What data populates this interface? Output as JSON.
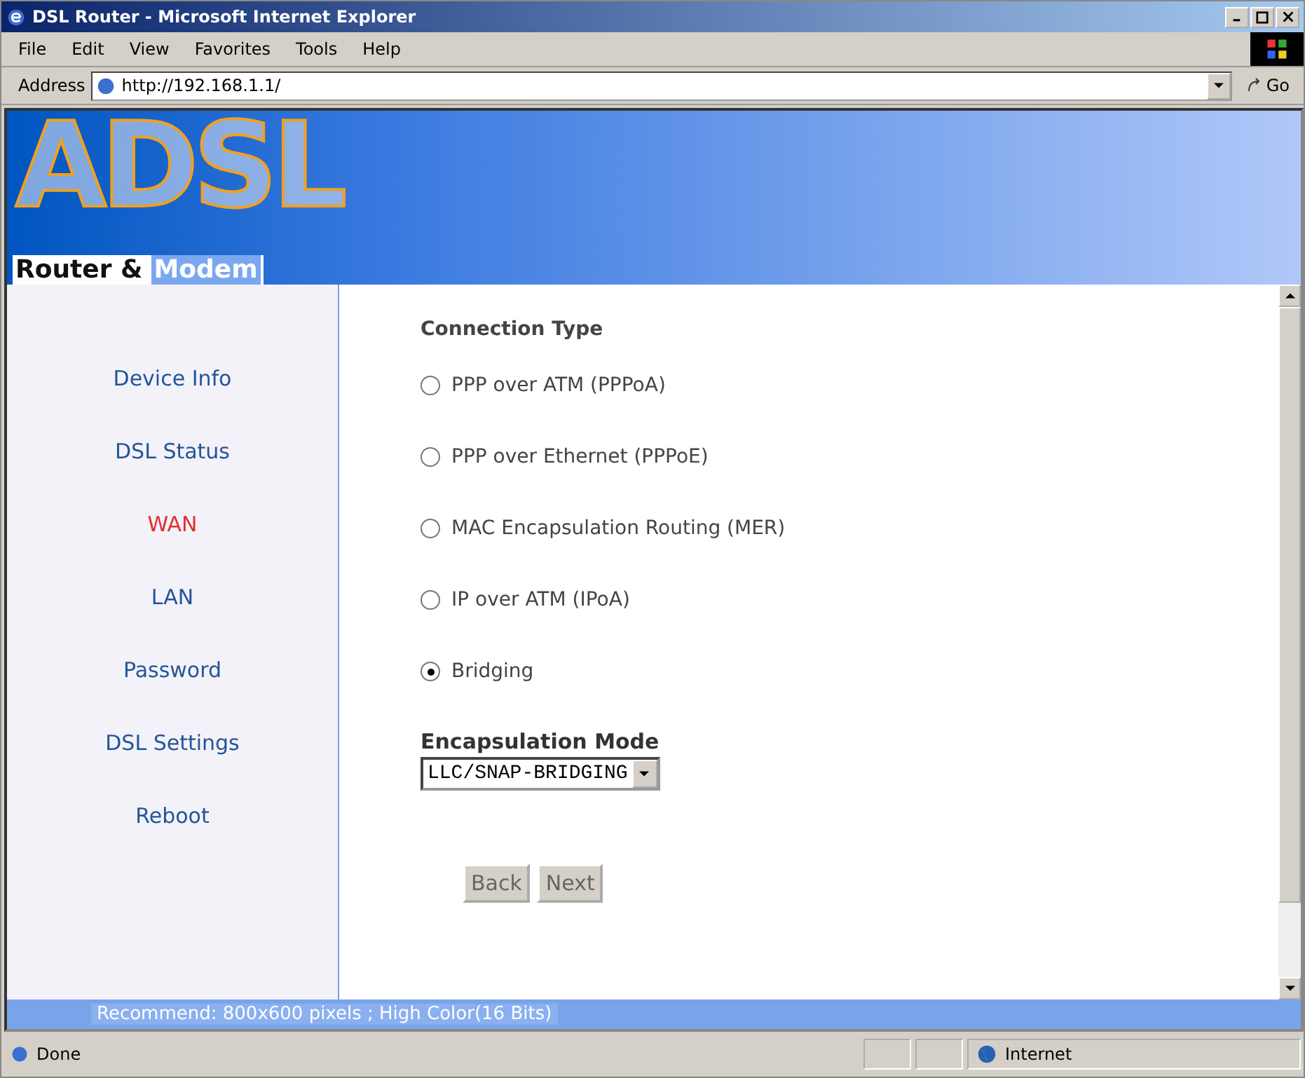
{
  "window": {
    "title": "DSL Router - Microsoft Internet Explorer"
  },
  "menu": [
    "File",
    "Edit",
    "View",
    "Favorites",
    "Tools",
    "Help"
  ],
  "address": {
    "label": "Address",
    "url": "http://192.168.1.1/",
    "go": "Go"
  },
  "banner": {
    "logo": "ADSL",
    "tagline_1": "Router &",
    "tagline_2": "Modem"
  },
  "sidebar": {
    "items": [
      {
        "label": "Device Info",
        "selected": false
      },
      {
        "label": "DSL Status",
        "selected": false
      },
      {
        "label": "WAN",
        "selected": true
      },
      {
        "label": "LAN",
        "selected": false
      },
      {
        "label": "Password",
        "selected": false
      },
      {
        "label": "DSL Settings",
        "selected": false
      },
      {
        "label": "Reboot",
        "selected": false
      }
    ]
  },
  "connection_type": {
    "heading": "Connection Type",
    "options": [
      {
        "label": "PPP over ATM (PPPoA)",
        "selected": false
      },
      {
        "label": "PPP over Ethernet (PPPoE)",
        "selected": false
      },
      {
        "label": "MAC Encapsulation Routing (MER)",
        "selected": false
      },
      {
        "label": "IP over ATM (IPoA)",
        "selected": false
      },
      {
        "label": "Bridging",
        "selected": true
      }
    ]
  },
  "encapsulation": {
    "heading": "Encapsulation Mode",
    "value": "LLC/SNAP-BRIDGING"
  },
  "buttons": [
    "Back",
    "Next"
  ],
  "footer": "Recommend: 800x600 pixels ; High Color(16 Bits)",
  "status_bar": {
    "text": "Done",
    "zone": "Internet"
  }
}
